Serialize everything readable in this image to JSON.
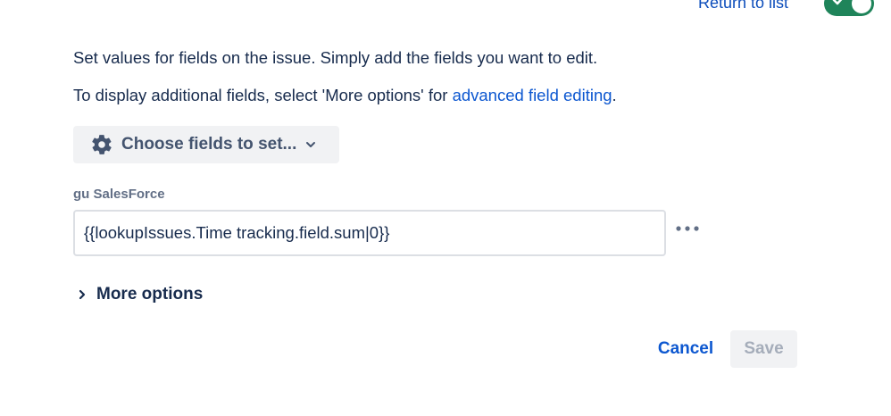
{
  "header": {
    "return_link": "Return to list",
    "toggle_enabled": true,
    "toggle_color": "#1f845a"
  },
  "intro": {
    "line1": "Set values for fields on the issue. Simply add the fields you want to edit.",
    "line2_prefix": "To display additional fields, select 'More options' for ",
    "line2_link": "advanced field editing",
    "line2_suffix": "."
  },
  "choose_fields": {
    "icon": "gear-icon",
    "label": "Choose fields to set...",
    "dropdown_icon": "chevron-down-icon"
  },
  "field": {
    "label": "gu SalesForce",
    "value": "{{lookupIssues.Time tracking.field.sum|0}}",
    "menu_icon": "more-horizontal-icon"
  },
  "more_options": {
    "icon": "chevron-right-icon",
    "label": "More options"
  },
  "actions": {
    "cancel": "Cancel",
    "save": "Save",
    "save_disabled": true
  },
  "colors": {
    "link": "#0c57d0",
    "text": "#172b4d",
    "subtle": "#626f86",
    "button_bg": "#f1f2f4"
  }
}
